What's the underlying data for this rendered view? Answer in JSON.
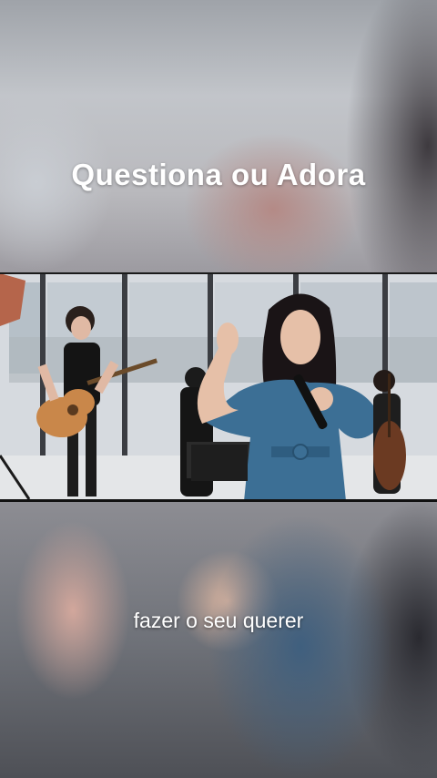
{
  "overlay": {
    "title": "Questiona ou Adora"
  },
  "subtitle": {
    "text": "fazer o seu querer"
  },
  "colors": {
    "text": "#ffffff",
    "dress": "#3c6f95",
    "hair": "#1a1416",
    "guitar": "#c9874a"
  }
}
